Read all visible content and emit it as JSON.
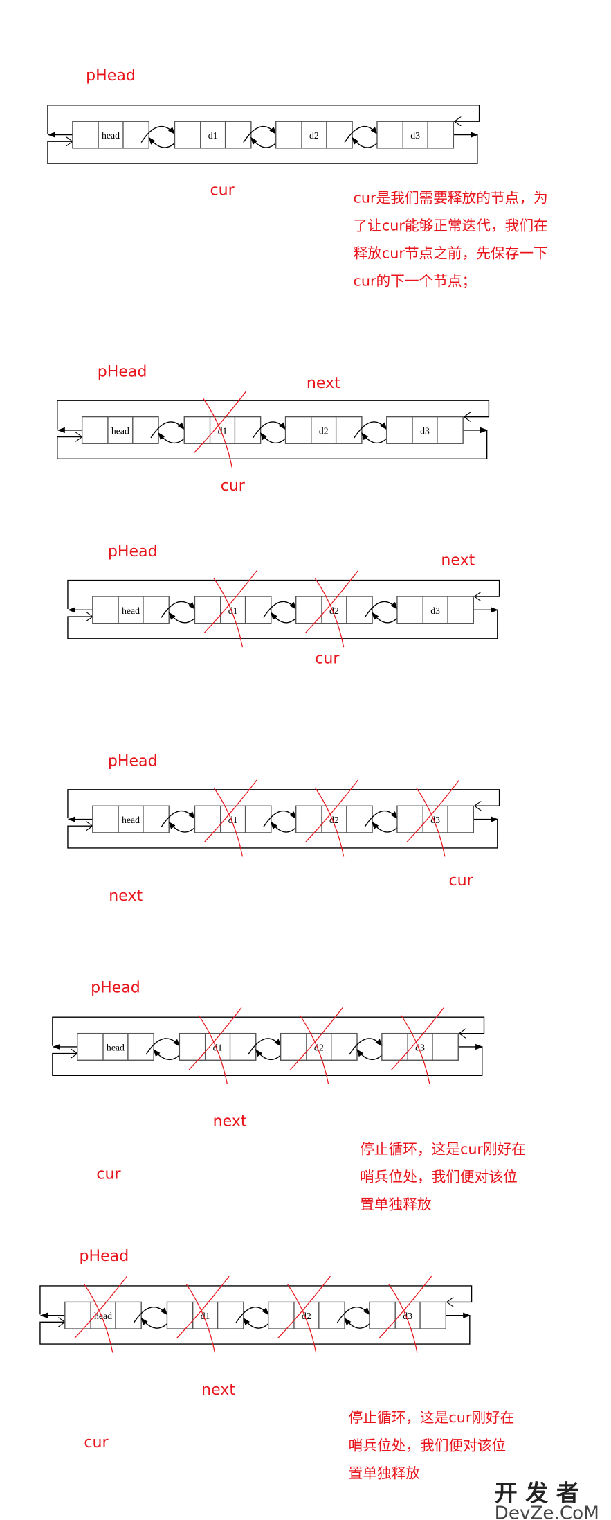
{
  "colors": {
    "annotation": "#e8141b",
    "line": "#000000",
    "box_border": "#555555"
  },
  "node_labels": [
    "head",
    "d1",
    "d2",
    "d3"
  ],
  "diagrams": [
    {
      "labels": {
        "phead": "pHead",
        "cur": "cur"
      },
      "crossed": [],
      "note": [
        "cur是我们需要释放的节点，为",
        "了让cur能够正常迭代，我们在",
        "释放cur节点之前，先保存一下",
        "cur的下一个节点；"
      ]
    },
    {
      "labels": {
        "phead": "pHead",
        "next": "next",
        "cur": "cur"
      },
      "crossed": [
        "d1"
      ],
      "note": []
    },
    {
      "labels": {
        "phead": "pHead",
        "next": "next",
        "cur": "cur"
      },
      "crossed": [
        "d1",
        "d2"
      ],
      "note": []
    },
    {
      "labels": {
        "phead": "pHead",
        "cur": "cur",
        "next": "next"
      },
      "crossed": [
        "d1",
        "d2",
        "d3"
      ],
      "note": []
    },
    {
      "labels": {
        "phead": "pHead",
        "next": "next",
        "cur": "cur"
      },
      "crossed": [
        "d1",
        "d2",
        "d3"
      ],
      "note": [
        "停止循环，这是cur刚好在",
        "哨兵位处，我们便对该位",
        "置单独释放"
      ]
    },
    {
      "labels": {
        "phead": "pHead",
        "next": "next",
        "cur": "cur"
      },
      "crossed": [
        "head",
        "d1",
        "d2",
        "d3"
      ],
      "note": [
        "停止循环，这是cur刚好在",
        "哨兵位处，我们便对该位",
        "置单独释放"
      ]
    }
  ],
  "watermark": {
    "line1": "开 发 者",
    "line2": "DevZe.CoM"
  }
}
